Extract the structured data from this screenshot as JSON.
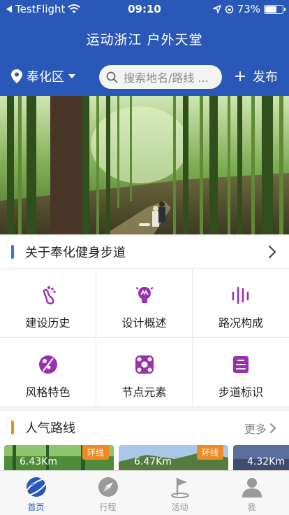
{
  "status_bar": {
    "carrier": "TestFlight",
    "time": "09:10",
    "battery": "73%",
    "battery_fraction": 0.73
  },
  "header": {
    "title": "运动浙江 户外天堂",
    "location": "奉化区",
    "search_placeholder": "搜索地名/路线 ...",
    "publish_label": "发布"
  },
  "about": {
    "title": "关于奉化健身步道",
    "accent": "#2a7ae2",
    "items": [
      {
        "label": "建设历史",
        "icon": "footprint-icon"
      },
      {
        "label": "设计概述",
        "icon": "lightbulb-icon"
      },
      {
        "label": "路况构成",
        "icon": "bars-icon"
      },
      {
        "label": "风格特色",
        "icon": "palette-icon"
      },
      {
        "label": "节点元素",
        "icon": "nodes-icon"
      },
      {
        "label": "步道标识",
        "icon": "sign-icon"
      }
    ],
    "icon_color": "#9b2fb2"
  },
  "popular": {
    "title": "人气路线",
    "accent": "#f08a24",
    "more_label": "更多",
    "routes": [
      {
        "distance": "6.43Km",
        "tag": "环线"
      },
      {
        "distance": "6.47Km",
        "tag": "环线"
      },
      {
        "distance": "4.32Km",
        "tag": ""
      }
    ]
  },
  "tabs": [
    {
      "label": "首页",
      "icon": "planet-icon",
      "active": true
    },
    {
      "label": "行程",
      "icon": "compass-icon",
      "active": false
    },
    {
      "label": "活动",
      "icon": "flag-icon",
      "active": false
    },
    {
      "label": "我",
      "icon": "user-icon",
      "active": false
    }
  ],
  "colors": {
    "header_bg": "#2a58b8",
    "active_tab": "#2a58b8",
    "inactive_tab": "#9a9a9a"
  }
}
